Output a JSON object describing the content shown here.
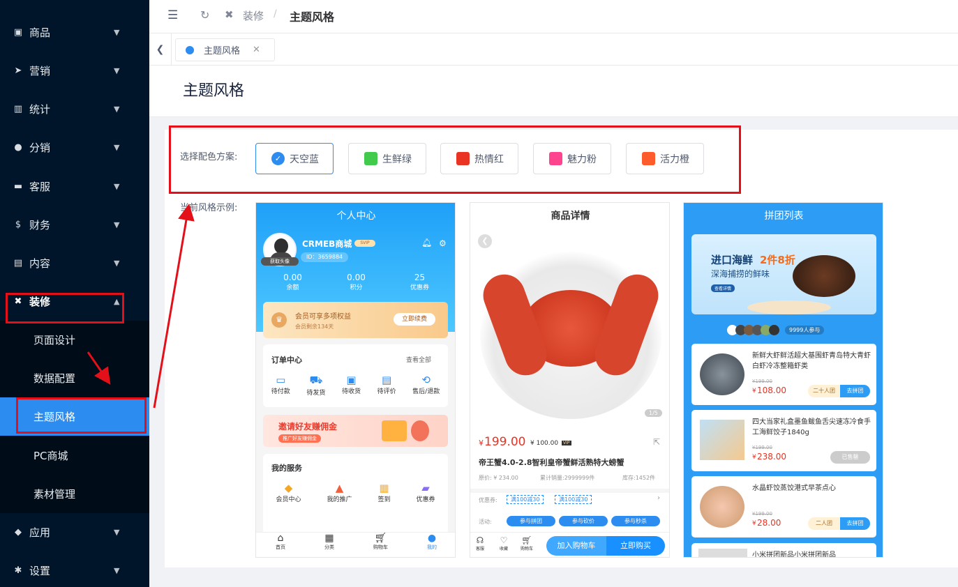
{
  "sidebar": {
    "items": [
      {
        "label": "商品",
        "icon": "bag-icon"
      },
      {
        "label": "营销",
        "icon": "send-icon"
      },
      {
        "label": "统计",
        "icon": "bar-chart-icon"
      },
      {
        "label": "分销",
        "icon": "users-icon"
      },
      {
        "label": "客服",
        "icon": "chat-icon"
      },
      {
        "label": "财务",
        "icon": "dollar-icon"
      },
      {
        "label": "内容",
        "icon": "book-icon"
      },
      {
        "label": "装修",
        "icon": "tools-icon"
      },
      {
        "label": "应用",
        "icon": "cube-icon"
      },
      {
        "label": "设置",
        "icon": "gear-icon"
      }
    ],
    "submenu": [
      "页面设计",
      "数据配置",
      "主题风格",
      "PC商城",
      "素材管理"
    ]
  },
  "header": {
    "crumb1": "装修",
    "sep": "/",
    "crumb2": "主题风格"
  },
  "tabs": {
    "active": "主题风格"
  },
  "page": {
    "title": "主题风格"
  },
  "theme": {
    "scheme_label": "选择配色方案:",
    "preview_label": "当前风格示例:",
    "schemes": [
      {
        "label": "天空蓝",
        "color": "#2d8cf0"
      },
      {
        "label": "生鲜绿",
        "color": "#42ca4d"
      },
      {
        "label": "热情红",
        "color": "#e93323"
      },
      {
        "label": "魅力粉",
        "color": "#ff448f"
      },
      {
        "label": "活力橙",
        "color": "#fe5c2d"
      }
    ]
  },
  "phone1": {
    "title": "个人中心",
    "name": "CRMEB商城",
    "svip": "SVIP",
    "avatar_tag": "获取头像",
    "id": "ID：3659884",
    "stats": [
      {
        "v": "0.00",
        "l": "余额"
      },
      {
        "v": "0.00",
        "l": "积分"
      },
      {
        "v": "25",
        "l": "优惠券"
      }
    ],
    "vip_title": "会员可享多项权益",
    "vip_sub": "会员剩余134天",
    "vip_btn": "立即续费",
    "orders_title": "订单中心",
    "orders_all": "查看全部",
    "orders": [
      "待付款",
      "待发货",
      "待收货",
      "待评价",
      "售后/退款"
    ],
    "invite_title": "邀请好友赚佣金",
    "invite_btn": "推广好友赚佣金",
    "services_title": "我的服务",
    "services": [
      "会员中心",
      "我的推广",
      "签到",
      "优惠券"
    ],
    "nav": [
      "首页",
      "分类",
      "购物车",
      "我的"
    ]
  },
  "phone2": {
    "title": "商品详情",
    "pager": "1/5",
    "price": "199.00",
    "vip_price": "¥ 100.00",
    "vip_tag": "VIP",
    "name": "帝王蟹4.0-2.8智利皇帝蟹鲜活熟特大螃蟹",
    "orig": "原价: ¥ 234.00",
    "sold": "累计销量:2999999件",
    "stock": "库存:1452件",
    "coupon_label": "优惠券:",
    "coupons": [
      "满100减30",
      "满100减30"
    ],
    "activity_label": "活动:",
    "activities": [
      "参与拼团",
      "参与砍价",
      "参与秒杀"
    ],
    "nav": [
      "客服",
      "收藏",
      "购物车"
    ],
    "cart": "加入购物车",
    "buy": "立即购买"
  },
  "phone3": {
    "title": "拼团列表",
    "banner_t1": "进口海鲜",
    "banner_t2": "2件8折",
    "banner_sub": "深海捕捞的鲜味",
    "banner_btn": "查看详情",
    "joined": "9999人参与",
    "items": [
      {
        "name": "新鲜大虾鲜活超大基围虾青岛特大青虾白虾冷冻整箱虾类",
        "old": "¥199.00",
        "price": "108.00",
        "tag": "二十人团",
        "btn": "去拼团"
      },
      {
        "name": "四大当家礼盒墨鱼鲅鱼舌尖速冻冷食手工海鲜饺子1840g",
        "old": "¥199.00",
        "price": "238.00",
        "tag": "",
        "btn": "已售罄"
      },
      {
        "name": "水晶虾饺蒸饺港式早茶点心",
        "old": "¥199.00",
        "price": "28.00",
        "tag": "二人团",
        "btn": "去拼团"
      },
      {
        "name": "小米拼团新品小米拼团新品",
        "old": "",
        "price": "",
        "tag": "",
        "btn": ""
      }
    ]
  }
}
